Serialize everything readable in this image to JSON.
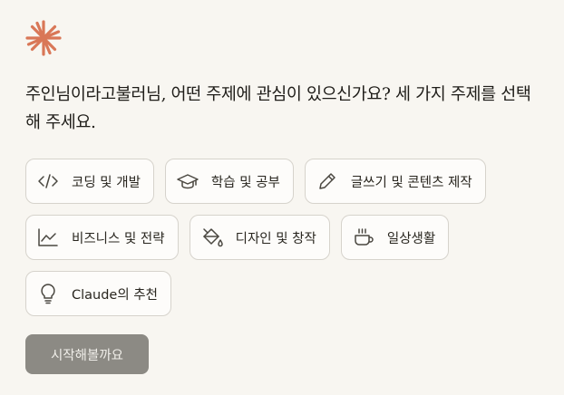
{
  "logo": {
    "icon": "claude-starburst-icon",
    "color": "#d97757"
  },
  "question": "주인님이라고불러님, 어떤 주제에 관심이 있으신가요? 세 가지 주제를 선택해 주세요.",
  "topics": [
    {
      "label": "코딩 및 개발",
      "icon": "code-icon"
    },
    {
      "label": "학습 및 공부",
      "icon": "graduation-cap-icon"
    },
    {
      "label": "글쓰기 및 콘텐츠 제작",
      "icon": "pencil-icon"
    },
    {
      "label": "비즈니스 및 전략",
      "icon": "line-chart-icon"
    },
    {
      "label": "디자인 및 창작",
      "icon": "paint-bucket-icon"
    },
    {
      "label": "일상생활",
      "icon": "coffee-cup-icon"
    },
    {
      "label": "Claude의 추천",
      "icon": "lightbulb-icon"
    }
  ],
  "start_button": {
    "label": "시작해볼까요",
    "color": "#8c8a84"
  }
}
